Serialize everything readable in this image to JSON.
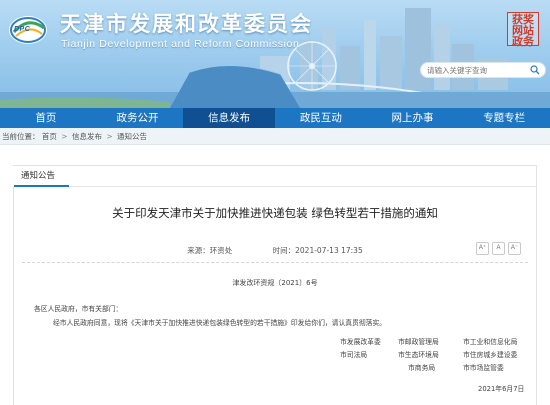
{
  "header": {
    "site_title": "天津市发展和改革委员会",
    "site_subtitle": "Tianjin Development and Reform Commission",
    "logo_text": "DPC",
    "seal_chars": [
      "获奖",
      "网站",
      "政务"
    ],
    "search_placeholder": "请输入关键字查询"
  },
  "nav": {
    "items": [
      "首页",
      "政务公开",
      "信息发布",
      "政民互动",
      "网上办事",
      "专题专栏"
    ],
    "active_index": 2
  },
  "breadcrumb": {
    "prefix": "当前位置：",
    "items": [
      "首页",
      "信息发布",
      "通知公告"
    ],
    "separator": ">"
  },
  "section_tab": "通知公告",
  "article": {
    "title": "关于印发天津市关于加快推进快递包装 绿色转型若干措施的通知",
    "source_label": "来源：环资处",
    "date_label": "时间：2021-07-13 17:35",
    "font_buttons": [
      "A⁺",
      "A",
      "A⁻"
    ],
    "doc_number": "津发改环资规〔2021〕6号",
    "salutation": "各区人民政府，市有关部门：",
    "body": "经市人民政府同意，现将《天津市关于加快推进快递包装绿色转型的若干措施》印发给你们，请认真贯彻落实。",
    "signatories": [
      [
        "市发展改革委",
        "市邮政管理局",
        "市工业和信息化局"
      ],
      [
        "市司法局",
        "市生态环境局",
        "市住房城乡建设委"
      ],
      [
        "",
        "市商务局",
        "市市场监管委"
      ]
    ],
    "sign_date": "2021年6月7日"
  },
  "colors": {
    "nav_bg": "#1d76c4",
    "nav_active": "#0f4f92",
    "banner_sky": "#9fcdee"
  }
}
